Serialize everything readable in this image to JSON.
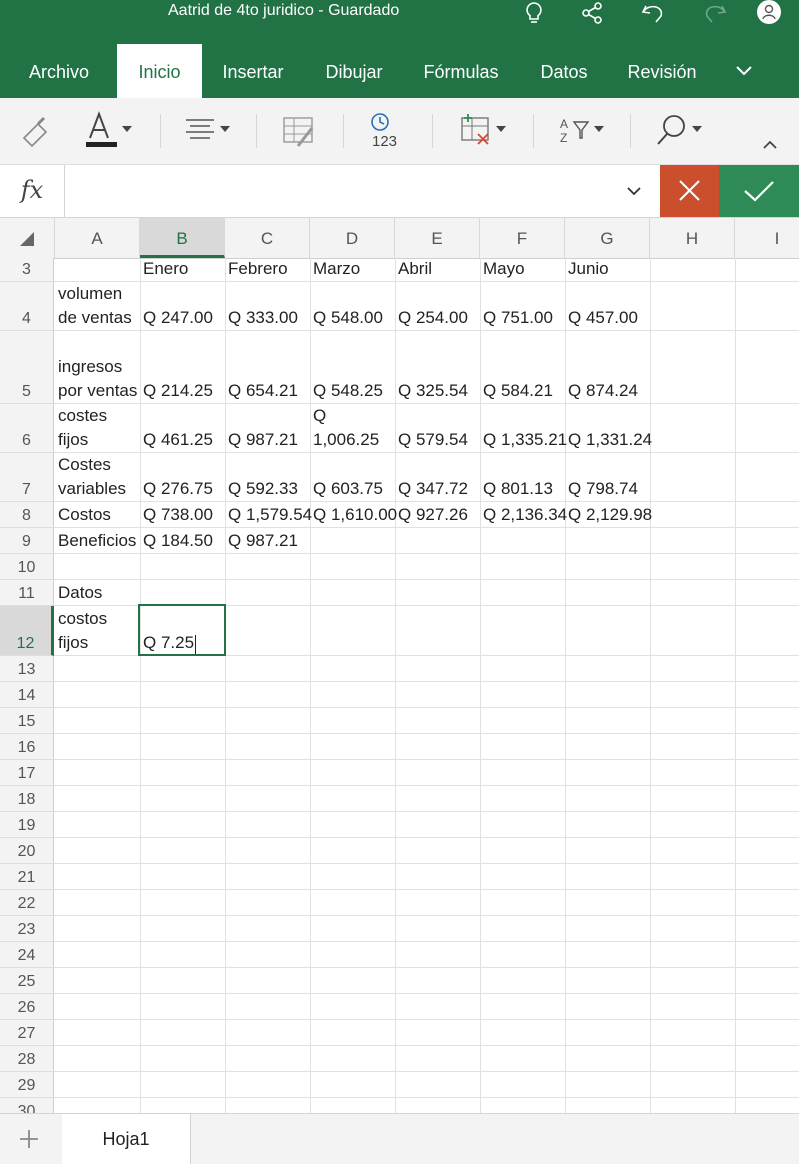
{
  "window": {
    "title": "Aatrid de 4to juridico - Guardado"
  },
  "ribbon": {
    "tabs": [
      {
        "label": "Archivo"
      },
      {
        "label": "Inicio"
      },
      {
        "label": "Insertar"
      },
      {
        "label": "Dibujar"
      },
      {
        "label": "Fórmulas"
      },
      {
        "label": "Datos"
      },
      {
        "label": "Revisión"
      }
    ],
    "active_tab": "Inicio",
    "toolbar_icons": [
      "format-painter-icon",
      "font-color-icon",
      "align-icon",
      "cell-styles-icon",
      "number-format-icon",
      "table-icon",
      "sort-filter-icon",
      "search-icon",
      "collapse-ribbon-icon"
    ]
  },
  "formula_bar": {
    "fx_label": "fx",
    "value": ""
  },
  "columns": [
    "A",
    "B",
    "C",
    "D",
    "E",
    "F",
    "G",
    "H",
    "I"
  ],
  "selected_column": "B",
  "selected_row": "12",
  "rows": [
    {
      "num": "3",
      "cells": {
        "B": "Enero",
        "C": "Febrero",
        "D": "Marzo",
        "E": "Abril",
        "F": "Mayo",
        "G": "Junio"
      }
    },
    {
      "num": "4",
      "cells": {
        "A": "volumen de ventas",
        "B": "Q 247.00",
        "C": "Q 333.00",
        "D": "Q 548.00",
        "E": "Q 254.00",
        "F": "Q 751.00",
        "G": "Q 457.00"
      }
    },
    {
      "num": "5",
      "cells": {
        "A": "ingresos por ventas",
        "B": "Q 214.25",
        "C": "Q 654.21",
        "D": "Q 548.25",
        "E": "Q 325.54",
        "F": "Q 584.21",
        "G": "Q 874.24"
      }
    },
    {
      "num": "6",
      "cells": {
        "A": "costes fijos",
        "B": "Q 461.25",
        "C": "Q 987.21",
        "D": "Q 1,006.25",
        "E": "Q 579.54",
        "F": "Q 1,335.21",
        "G": "Q 1,331.24"
      }
    },
    {
      "num": "7",
      "cells": {
        "A": "Costes variables",
        "B": "Q 276.75",
        "C": "Q 592.33",
        "D": "Q 603.75",
        "E": "Q 347.72",
        "F": "Q 801.13",
        "G": "Q 798.74"
      }
    },
    {
      "num": "8",
      "cells": {
        "A": "Costos",
        "B": "Q 738.00",
        "C": "Q 1,579.54",
        "D": "Q 1,610.00",
        "E": "Q 927.26",
        "F": "Q 2,136.34",
        "G": "Q 2,129.98"
      }
    },
    {
      "num": "9",
      "cells": {
        "A": "Beneficios",
        "B": "Q 184.50",
        "C": "Q 987.21"
      }
    },
    {
      "num": "10",
      "cells": {}
    },
    {
      "num": "11",
      "cells": {
        "A": "Datos"
      }
    },
    {
      "num": "12",
      "cells": {
        "A": "costos fijos",
        "B": "Q 7.25"
      }
    },
    {
      "num": "13",
      "cells": {}
    },
    {
      "num": "14",
      "cells": {}
    },
    {
      "num": "15",
      "cells": {}
    },
    {
      "num": "16",
      "cells": {}
    },
    {
      "num": "17",
      "cells": {}
    },
    {
      "num": "18",
      "cells": {}
    },
    {
      "num": "19",
      "cells": {}
    },
    {
      "num": "20",
      "cells": {}
    },
    {
      "num": "21",
      "cells": {}
    },
    {
      "num": "22",
      "cells": {}
    },
    {
      "num": "23",
      "cells": {}
    },
    {
      "num": "24",
      "cells": {}
    },
    {
      "num": "25",
      "cells": {}
    },
    {
      "num": "26",
      "cells": {}
    },
    {
      "num": "27",
      "cells": {}
    },
    {
      "num": "28",
      "cells": {}
    },
    {
      "num": "29",
      "cells": {}
    },
    {
      "num": "30",
      "cells": {}
    }
  ],
  "sheets": [
    {
      "label": "Hoja1"
    }
  ],
  "sheet_add_label": "+",
  "colors": {
    "accent": "#217346",
    "cancel": "#cb4e2d",
    "confirm": "#2e8b57"
  }
}
